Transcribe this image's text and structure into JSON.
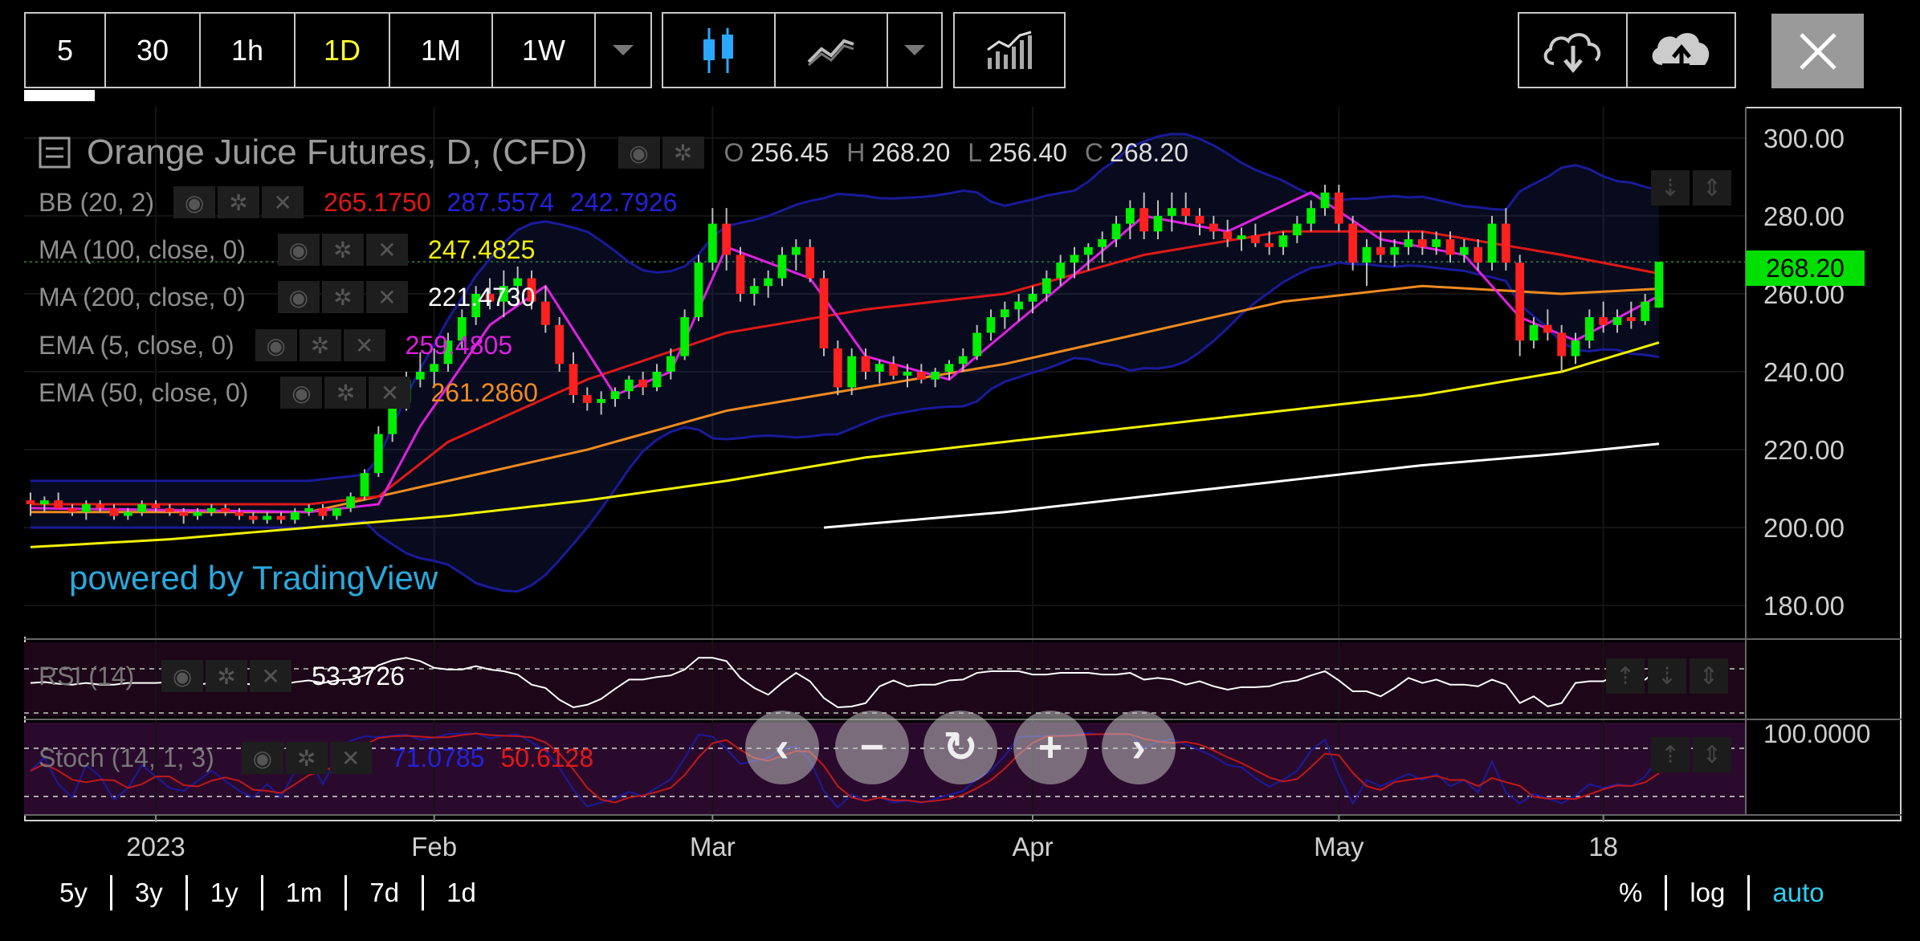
{
  "toolbar": {
    "intervals": [
      {
        "label": "5",
        "active": false
      },
      {
        "label": "30",
        "active": false
      },
      {
        "label": "1h",
        "active": false
      },
      {
        "label": "1D",
        "active": true
      },
      {
        "label": "1M",
        "active": false
      },
      {
        "label": "1W",
        "active": false
      }
    ],
    "chart_style_icons": [
      "candlestick-icon",
      "line-chart-icon",
      "chevron-down-icon"
    ],
    "indicators_icon": "indicators-icon",
    "save_icons": [
      "cloud-download-icon",
      "cloud-upload-icon"
    ],
    "close_icon": "close-icon"
  },
  "header": {
    "symbol": "Orange Juice Futures, D, (CFD)",
    "o_label": "O",
    "o_value": "256.45",
    "h_label": "H",
    "h_value": "268.20",
    "l_label": "L",
    "l_value": "256.40",
    "c_label": "C",
    "c_value": "268.20"
  },
  "indicators": [
    {
      "label": "BB (20, 2)",
      "values": [
        "265.1750",
        "287.5574",
        "242.7926"
      ],
      "colors": [
        "#e01818",
        "#2222dd",
        "#2222dd"
      ]
    },
    {
      "label": "MA (100, close, 0)",
      "values": [
        "247.4825"
      ],
      "colors": [
        "#f0f000"
      ]
    },
    {
      "label": "MA (200, close, 0)",
      "values": [
        "221.4730"
      ],
      "colors": [
        "#ffffff"
      ]
    },
    {
      "label": "EMA (5, close, 0)",
      "values": [
        "259.4805"
      ],
      "colors": [
        "#e020e0"
      ]
    },
    {
      "label": "EMA (50, close, 0)",
      "values": [
        "261.2860"
      ],
      "colors": [
        "#f08a20"
      ]
    }
  ],
  "watermark": "powered by TradingView",
  "rsi": {
    "label": "RSI (14)",
    "value": "53.3726"
  },
  "stoch": {
    "label": "Stoch (14, 1, 3)",
    "k_value": "71.0785",
    "d_value": "50.6128",
    "axis_label": "100.0000"
  },
  "last_price": "268.20",
  "zoom_controls": [
    "chevron-left-icon",
    "minus-icon",
    "reset-icon",
    "plus-icon",
    "chevron-right-icon"
  ],
  "range_buttons": [
    "5y",
    "3y",
    "1y",
    "1m",
    "7d",
    "1d"
  ],
  "scale_buttons": [
    {
      "label": "%",
      "active": false
    },
    {
      "label": "log",
      "active": false
    },
    {
      "label": "auto",
      "active": true
    }
  ],
  "chart_data": {
    "type": "candlestick",
    "title": "Orange Juice Futures, D, (CFD)",
    "y_ticks": [
      180,
      200,
      220,
      240,
      260,
      280,
      300
    ],
    "ylim": [
      172,
      308
    ],
    "x_ticks": [
      "2023",
      "Feb",
      "Mar",
      "Apr",
      "May",
      "18"
    ],
    "candles": [
      [
        207,
        209,
        203,
        206
      ],
      [
        206,
        208,
        204,
        207
      ],
      [
        207,
        209,
        205,
        205
      ],
      [
        205,
        206,
        203,
        204
      ],
      [
        204,
        207,
        202,
        206
      ],
      [
        206,
        207,
        204,
        205
      ],
      [
        205,
        206,
        202,
        203
      ],
      [
        203,
        205,
        202,
        204
      ],
      [
        204,
        207,
        203,
        206
      ],
      [
        206,
        207,
        204,
        205
      ],
      [
        205,
        206,
        203,
        204
      ],
      [
        204,
        205,
        201,
        203
      ],
      [
        203,
        205,
        202,
        204
      ],
      [
        204,
        206,
        203,
        205
      ],
      [
        205,
        206,
        203,
        204
      ],
      [
        204,
        205,
        202,
        203
      ],
      [
        203,
        204,
        201,
        202
      ],
      [
        202,
        204,
        201,
        203
      ],
      [
        203,
        204,
        201,
        202
      ],
      [
        202,
        205,
        201,
        204
      ],
      [
        204,
        206,
        203,
        205
      ],
      [
        205,
        206,
        202,
        203
      ],
      [
        203,
        205,
        202,
        205
      ],
      [
        205,
        209,
        204,
        208
      ],
      [
        208,
        215,
        207,
        214
      ],
      [
        214,
        226,
        213,
        224
      ],
      [
        224,
        234,
        222,
        232
      ],
      [
        232,
        240,
        230,
        238
      ],
      [
        238,
        245,
        236,
        240
      ],
      [
        240,
        246,
        236,
        242
      ],
      [
        242,
        250,
        240,
        248
      ],
      [
        248,
        256,
        246,
        254
      ],
      [
        254,
        262,
        252,
        260
      ],
      [
        260,
        264,
        256,
        258
      ],
      [
        258,
        266,
        254,
        262
      ],
      [
        262,
        267,
        258,
        264
      ],
      [
        264,
        266,
        256,
        258
      ],
      [
        258,
        262,
        250,
        252
      ],
      [
        252,
        254,
        240,
        242
      ],
      [
        242,
        245,
        232,
        234
      ],
      [
        234,
        236,
        230,
        232
      ],
      [
        232,
        235,
        229,
        233
      ],
      [
        233,
        236,
        231,
        235
      ],
      [
        235,
        239,
        233,
        238
      ],
      [
        238,
        240,
        234,
        236
      ],
      [
        236,
        242,
        235,
        240
      ],
      [
        240,
        246,
        238,
        244
      ],
      [
        244,
        256,
        243,
        254
      ],
      [
        254,
        270,
        253,
        268
      ],
      [
        268,
        282,
        266,
        278
      ],
      [
        278,
        282,
        266,
        270
      ],
      [
        270,
        272,
        258,
        260
      ],
      [
        260,
        264,
        257,
        262
      ],
      [
        262,
        266,
        259,
        264
      ],
      [
        264,
        272,
        262,
        270
      ],
      [
        270,
        274,
        266,
        272
      ],
      [
        272,
        274,
        263,
        264
      ],
      [
        264,
        266,
        244,
        246
      ],
      [
        246,
        248,
        234,
        236
      ],
      [
        236,
        246,
        234,
        244
      ],
      [
        244,
        246,
        238,
        240
      ],
      [
        240,
        243,
        237,
        242
      ],
      [
        242,
        244,
        238,
        239
      ],
      [
        239,
        242,
        236,
        240
      ],
      [
        240,
        242,
        237,
        238
      ],
      [
        238,
        241,
        236,
        240
      ],
      [
        240,
        243,
        238,
        242
      ],
      [
        242,
        246,
        240,
        244
      ],
      [
        244,
        252,
        243,
        250
      ],
      [
        250,
        256,
        248,
        254
      ],
      [
        254,
        258,
        251,
        256
      ],
      [
        256,
        260,
        253,
        258
      ],
      [
        258,
        262,
        255,
        260
      ],
      [
        260,
        266,
        258,
        264
      ],
      [
        264,
        270,
        262,
        268
      ],
      [
        268,
        272,
        264,
        270
      ],
      [
        270,
        273,
        266,
        272
      ],
      [
        272,
        276,
        268,
        274
      ],
      [
        274,
        280,
        272,
        278
      ],
      [
        278,
        284,
        274,
        282
      ],
      [
        282,
        286,
        274,
        276
      ],
      [
        276,
        284,
        274,
        280
      ],
      [
        280,
        286,
        276,
        282
      ],
      [
        282,
        286,
        278,
        280
      ],
      [
        280,
        282,
        275,
        278
      ],
      [
        278,
        280,
        274,
        276
      ],
      [
        276,
        279,
        272,
        274
      ],
      [
        274,
        277,
        271,
        275
      ],
      [
        275,
        278,
        272,
        273
      ],
      [
        273,
        276,
        270,
        272
      ],
      [
        272,
        276,
        270,
        275
      ],
      [
        275,
        280,
        273,
        278
      ],
      [
        278,
        284,
        276,
        282
      ],
      [
        282,
        288,
        280,
        286
      ],
      [
        286,
        288,
        276,
        278
      ],
      [
        278,
        280,
        266,
        268
      ],
      [
        268,
        274,
        262,
        272
      ],
      [
        272,
        276,
        268,
        270
      ],
      [
        270,
        274,
        267,
        272
      ],
      [
        272,
        276,
        270,
        274
      ],
      [
        274,
        276,
        270,
        272
      ],
      [
        272,
        276,
        270,
        274
      ],
      [
        274,
        276,
        268,
        270
      ],
      [
        270,
        274,
        268,
        272
      ],
      [
        272,
        274,
        266,
        268
      ],
      [
        268,
        280,
        266,
        278
      ],
      [
        278,
        282,
        266,
        268
      ],
      [
        268,
        270,
        244,
        248
      ],
      [
        248,
        254,
        246,
        252
      ],
      [
        252,
        256,
        248,
        250
      ],
      [
        250,
        252,
        240,
        244
      ],
      [
        244,
        250,
        242,
        248
      ],
      [
        248,
        256,
        246,
        254
      ],
      [
        254,
        258,
        250,
        252
      ],
      [
        252,
        256,
        250,
        254
      ],
      [
        254,
        258,
        251,
        253
      ],
      [
        253,
        260,
        252,
        258
      ],
      [
        256.45,
        268.2,
        256.4,
        268.2
      ]
    ],
    "series": [
      {
        "name": "MA (100, close, 0)",
        "color": "#f0f000",
        "values": [
          [
            0,
            195
          ],
          [
            10,
            197
          ],
          [
            20,
            200
          ],
          [
            30,
            203
          ],
          [
            40,
            207
          ],
          [
            50,
            212
          ],
          [
            60,
            218
          ],
          [
            70,
            222
          ],
          [
            80,
            226
          ],
          [
            90,
            230
          ],
          [
            100,
            234
          ],
          [
            110,
            240
          ],
          [
            117,
            247.5
          ]
        ]
      },
      {
        "name": "MA (200, close, 0)",
        "color": "#ffffff",
        "values": [
          [
            57,
            200
          ],
          [
            70,
            204
          ],
          [
            80,
            208
          ],
          [
            90,
            212
          ],
          [
            100,
            216
          ],
          [
            110,
            219
          ],
          [
            117,
            221.5
          ]
        ]
      },
      {
        "name": "EMA (50, close, 0)",
        "color": "#f08a20",
        "values": [
          [
            0,
            204
          ],
          [
            20,
            204
          ],
          [
            30,
            212
          ],
          [
            40,
            220
          ],
          [
            50,
            230
          ],
          [
            60,
            236
          ],
          [
            70,
            242
          ],
          [
            80,
            250
          ],
          [
            90,
            258
          ],
          [
            100,
            262
          ],
          [
            110,
            260
          ],
          [
            117,
            261.3
          ]
        ]
      },
      {
        "name": "BB (20, 2)",
        "color": "#e01818",
        "values": [
          [
            0,
            206
          ],
          [
            20,
            206
          ],
          [
            25,
            208
          ],
          [
            30,
            222
          ],
          [
            40,
            238
          ],
          [
            50,
            250
          ],
          [
            60,
            256
          ],
          [
            70,
            260
          ],
          [
            80,
            270
          ],
          [
            90,
            276
          ],
          [
            100,
            276
          ],
          [
            110,
            270
          ],
          [
            117,
            265.2
          ]
        ]
      },
      {
        "name": "EMA (5, close, 0)",
        "color": "#e020e0",
        "values": [
          [
            0,
            205
          ],
          [
            20,
            204
          ],
          [
            25,
            206
          ],
          [
            28,
            226
          ],
          [
            33,
            252
          ],
          [
            37,
            262
          ],
          [
            42,
            234
          ],
          [
            46,
            240
          ],
          [
            50,
            272
          ],
          [
            56,
            264
          ],
          [
            60,
            244
          ],
          [
            66,
            238
          ],
          [
            72,
            256
          ],
          [
            80,
            280
          ],
          [
            86,
            276
          ],
          [
            92,
            286
          ],
          [
            97,
            274
          ],
          [
            103,
            270
          ],
          [
            107,
            254
          ],
          [
            111,
            248
          ],
          [
            117,
            259.5
          ]
        ]
      }
    ]
  }
}
